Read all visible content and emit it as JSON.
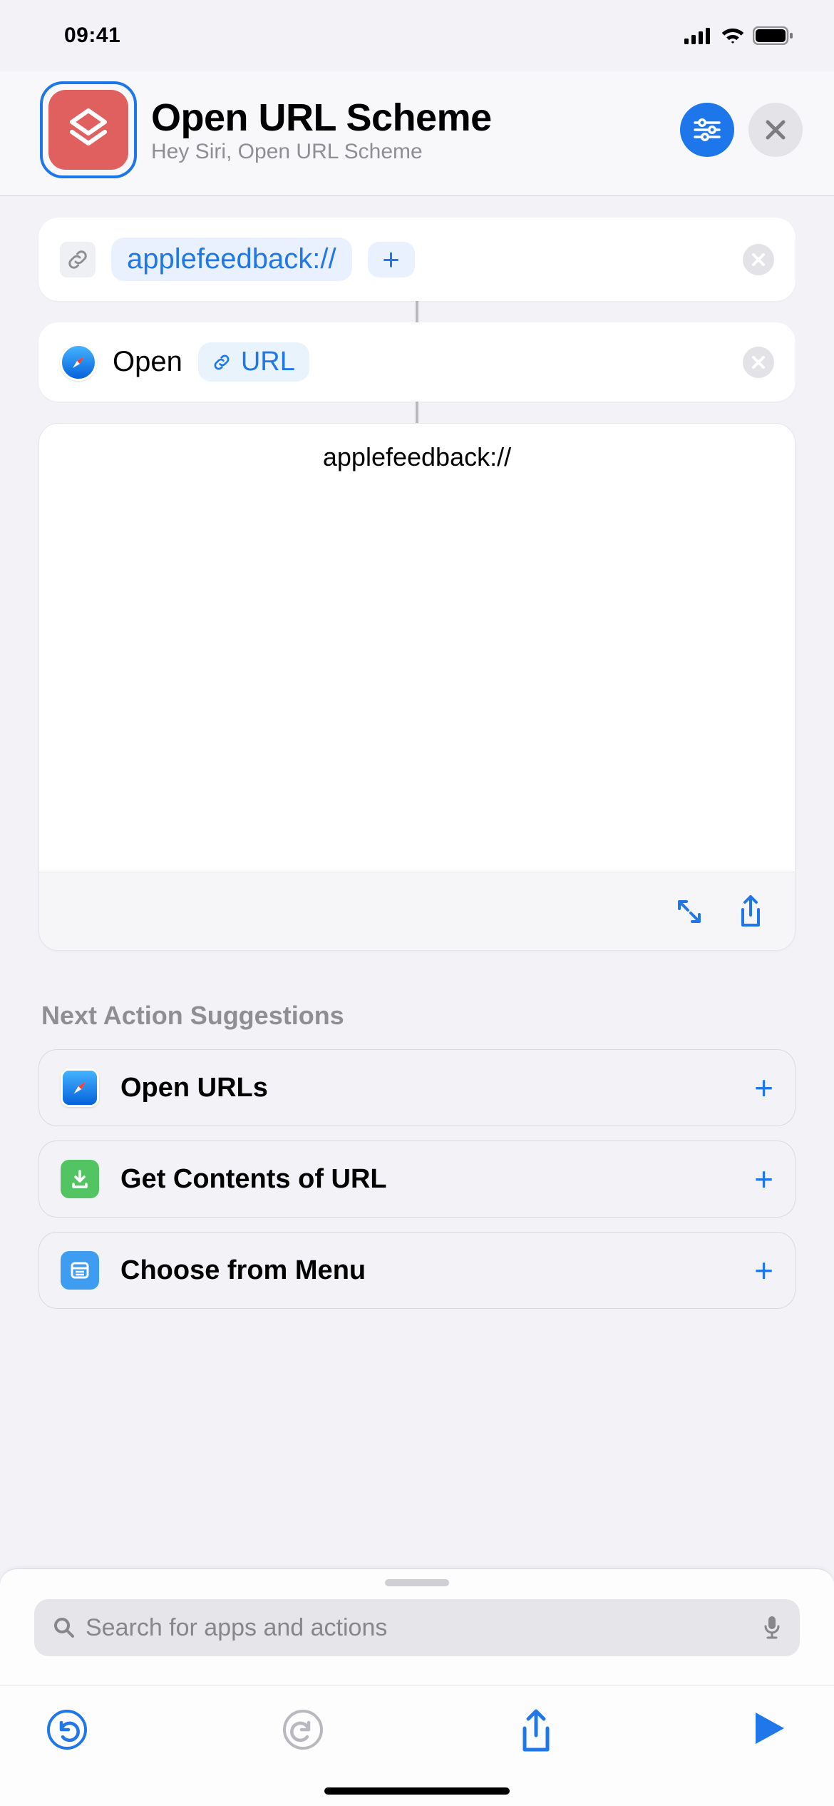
{
  "status": {
    "time": "09:41"
  },
  "header": {
    "title": "Open URL Scheme",
    "subtitle": "Hey Siri, Open URL Scheme"
  },
  "action1": {
    "url_text": "applefeedback://"
  },
  "action2": {
    "label": "Open",
    "variable": "URL"
  },
  "preview": {
    "text": "applefeedback://"
  },
  "suggestions": {
    "header": "Next Action Suggestions",
    "items": [
      {
        "label": "Open URLs",
        "icon": "safari"
      },
      {
        "label": "Get Contents of URL",
        "icon": "download"
      },
      {
        "label": "Choose from Menu",
        "icon": "menu"
      }
    ]
  },
  "search": {
    "placeholder": "Search for apps and actions"
  }
}
